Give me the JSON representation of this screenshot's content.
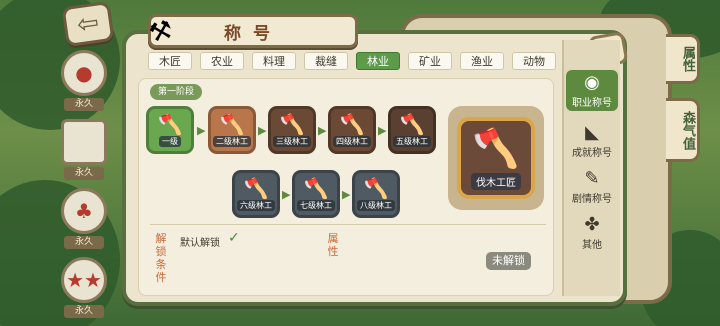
{
  "window": {
    "title": "称号",
    "close_label": "✕",
    "back_label": "⇦"
  },
  "left_slots": [
    {
      "icon": "hair-icon",
      "tag": "永久"
    },
    {
      "icon": "blank-icon",
      "tag": "永久"
    },
    {
      "icon": "carrot-icon",
      "tag": "永久"
    },
    {
      "icon": "stars-icon",
      "tag": "永久"
    }
  ],
  "background_tabs": [
    "属性",
    "森气值"
  ],
  "tabs": [
    {
      "label": "木匠",
      "active": false
    },
    {
      "label": "农业",
      "active": false
    },
    {
      "label": "料理",
      "active": false
    },
    {
      "label": "裁缝",
      "active": false
    },
    {
      "label": "林业",
      "active": true
    },
    {
      "label": "矿业",
      "active": false
    },
    {
      "label": "渔业",
      "active": false
    },
    {
      "label": "动物",
      "active": false
    }
  ],
  "stage_label": "第一阶段",
  "badges_row1": [
    "一级",
    "二级林工",
    "三级林工",
    "四级林工",
    "五级林工"
  ],
  "badges_row2": [
    "六级林工",
    "七级林工",
    "八级林工"
  ],
  "selected_badge": {
    "label": "伐木工匠"
  },
  "condition": {
    "title": "解锁条件",
    "text": "默认解锁",
    "check": "✓"
  },
  "attribute": {
    "title": "属性"
  },
  "lock_status": "未解锁",
  "right_nav": [
    {
      "label": "职业称号",
      "icon": "badge-icon",
      "active": true
    },
    {
      "label": "成就称号",
      "icon": "fan-icon",
      "active": false
    },
    {
      "label": "剧情称号",
      "icon": "scroll-icon",
      "active": false
    },
    {
      "label": "其他",
      "icon": "clover-icon",
      "active": false
    }
  ],
  "colors": {
    "accent_green": "#5d9a4a",
    "frame": "#58703f",
    "paper": "#ece4cc"
  }
}
